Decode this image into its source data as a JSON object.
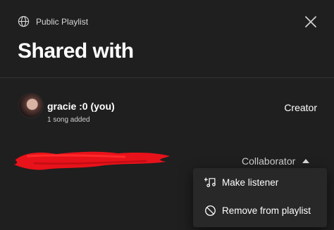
{
  "dialog": {
    "tag_label": "Public Playlist",
    "title": "Shared with"
  },
  "owner": {
    "name": "gracie :0 (you)",
    "subtitle": "1 song added",
    "role": "Creator"
  },
  "collaborator": {
    "name_redacted": true,
    "role": "Collaborator"
  },
  "role_menu": {
    "items": [
      {
        "label": "Make listener",
        "icon": "music-note-icon"
      },
      {
        "label": "Remove from playlist",
        "icon": "block-icon"
      }
    ]
  },
  "colors": {
    "background": "#1f1f1f",
    "menu_background": "#282828",
    "redaction": "#e8121a"
  }
}
